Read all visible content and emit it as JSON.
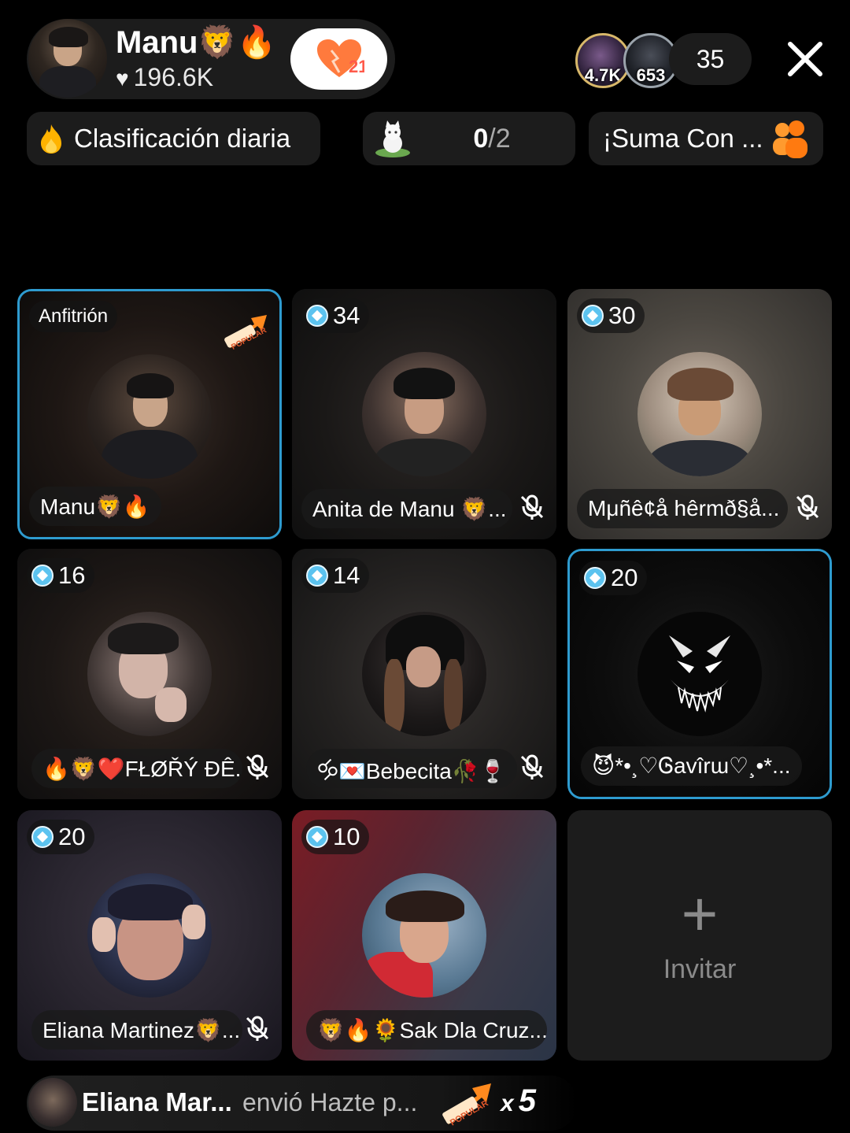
{
  "header": {
    "host_name": "Manu🦁🔥",
    "host_likes": "196.6K",
    "follow_count": "21",
    "viewers": [
      {
        "count": "4.7K"
      },
      {
        "count": "653"
      }
    ],
    "viewer_total": "35"
  },
  "chips": {
    "ranking_label": "Clasificación diaria",
    "progress_current": "0",
    "progress_total": "/2",
    "promo_label": "¡Suma Con ..."
  },
  "grid": {
    "cards": [
      {
        "tag": "Anfitrión",
        "name": "Manu🦁🔥",
        "popular": true
      },
      {
        "level": "34",
        "name": "Anita de Manu 🦁...",
        "muted": true
      },
      {
        "level": "30",
        "name": "Mμñê¢å hêrmð§å...",
        "muted": true
      },
      {
        "level": "16",
        "name": "🔥🦁❤️FŁØŘÝ ĐÊ...",
        "muted": true
      },
      {
        "level": "14",
        "name": "🝰💌Bebecita🥀🍷",
        "muted": true
      },
      {
        "level": "20",
        "name": "😈*•¸♡Ꮆavîrɯ♡¸•*..."
      },
      {
        "level": "20",
        "name": "Eliana Martinez🦁...",
        "muted": true
      },
      {
        "level": "10",
        "name": "🦁🔥🌻Sak Dla Cruz..."
      }
    ],
    "invite_label": "Invitar"
  },
  "gift": {
    "sender": "Eliana Mar...",
    "action": "envió Hazte p...",
    "multiplier_prefix": "x",
    "multiplier": "5"
  },
  "colors": {
    "selected_border": "#2e9bcf",
    "level_gem": "#5cc3ef",
    "follow_icon": "#ff7a3d"
  }
}
